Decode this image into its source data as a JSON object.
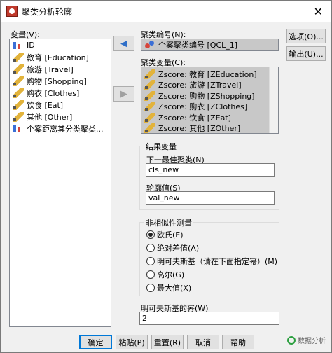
{
  "window": {
    "title": "聚类分析轮廓",
    "close_glyph": "✕"
  },
  "variables": {
    "label": "变量(V):",
    "items": [
      {
        "icon": "nominal-icon",
        "label": "ID"
      },
      {
        "icon": "scale-pencil-icon",
        "label": "教育 [Education]"
      },
      {
        "icon": "scale-pencil-icon",
        "label": "旅游 [Travel]"
      },
      {
        "icon": "scale-pencil-icon",
        "label": "购物 [Shopping]"
      },
      {
        "icon": "scale-pencil-icon",
        "label": "购衣 [Clothes]"
      },
      {
        "icon": "scale-pencil-icon",
        "label": "饮食 [Eat]"
      },
      {
        "icon": "scale-pencil-icon",
        "label": "其他 [Other]"
      },
      {
        "icon": "nominal-icon",
        "label": "个案距离其分类聚类..."
      }
    ]
  },
  "cluster_number": {
    "label": "聚类编号(N):",
    "value": "个案聚类编号 [QCL_1]"
  },
  "cluster_vars": {
    "label": "聚类变量(C):",
    "items": [
      {
        "label": "Zscore: 教育 [ZEducation]"
      },
      {
        "label": "Zscore: 旅游 [ZTravel]"
      },
      {
        "label": "Zscore: 购物 [ZShopping]"
      },
      {
        "label": "Zscore: 购衣 [ZClothes]"
      },
      {
        "label": "Zscore: 饮食 [ZEat]"
      },
      {
        "label": "Zscore: 其他 [ZOther]"
      }
    ]
  },
  "buttons": {
    "options": "选项(O)...",
    "output": "输出(U)...",
    "ok": "确定",
    "paste": "粘贴(P)",
    "reset": "重置(R)",
    "cancel": "取消",
    "help": "帮助"
  },
  "result_vars": {
    "title": "结果变量",
    "next_cluster_label": "下一最佳聚类(N)",
    "next_cluster_value": "cls_new",
    "silhouette_label": "轮廓值(S)",
    "silhouette_value": "val_new"
  },
  "dissimilarity": {
    "title": "非相似性测量",
    "options": [
      "欧氏(E)",
      "绝对差值(A)",
      "明可夫斯基（请在下面指定幂）(M)",
      "高尔(G)",
      "最大值(X)"
    ],
    "selected": "欧氏(E)"
  },
  "minkowski": {
    "label": "明可夫斯基的幂(W)",
    "value": "2"
  },
  "watermark": "数据分析"
}
